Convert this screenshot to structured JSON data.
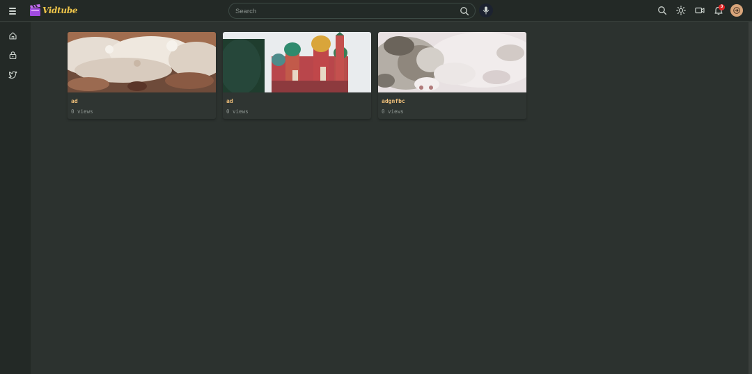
{
  "header": {
    "logo_text": "Vidtube",
    "search_placeholder": "Search",
    "notification_count": "3"
  },
  "icons": {
    "menu": "hamburger-menu-icon",
    "search": "search-icon",
    "mic": "microphone-icon",
    "theme": "sun-icon",
    "upload": "video-camera-icon",
    "notifications": "bell-icon",
    "login": "sign-in-icon"
  },
  "sidebar": {
    "items": [
      {
        "icon": "home-icon"
      },
      {
        "icon": "lock-icon"
      },
      {
        "icon": "twitter-icon"
      }
    ]
  },
  "videos": [
    {
      "title": "ad",
      "views": "0 views"
    },
    {
      "title": "ad",
      "views": "0 views"
    },
    {
      "title": "adgnfbc",
      "views": "0 views"
    }
  ],
  "colors": {
    "background": "#2c322f",
    "topbar": "#232926",
    "title": "#f0c07a",
    "badge": "#e02424",
    "logo": "#f0c64a"
  }
}
